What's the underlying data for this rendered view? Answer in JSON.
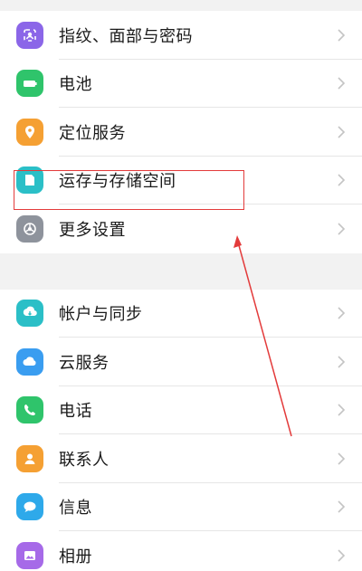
{
  "group1": [
    {
      "label": "指纹、面部与密码",
      "icon": "fingerprint-face-icon",
      "color": "#8b66e8"
    },
    {
      "label": "电池",
      "icon": "battery-icon",
      "color": "#2fc46b"
    },
    {
      "label": "定位服务",
      "icon": "location-pin-icon",
      "color": "#f5a033"
    },
    {
      "label": "运存与存储空间",
      "icon": "storage-icon",
      "color": "#2bbfc7"
    },
    {
      "label": "更多设置",
      "icon": "settings-gear-icon",
      "color": "#8e939c"
    }
  ],
  "group2": [
    {
      "label": "帐户与同步",
      "icon": "account-sync-icon",
      "color": "#2bbfc7"
    },
    {
      "label": "云服务",
      "icon": "cloud-icon",
      "color": "#3a9df0"
    },
    {
      "label": "电话",
      "icon": "phone-icon",
      "color": "#2fc46b"
    },
    {
      "label": "联系人",
      "icon": "contacts-icon",
      "color": "#f5a033"
    },
    {
      "label": "信息",
      "icon": "message-icon",
      "color": "#2ea9ea"
    },
    {
      "label": "相册",
      "icon": "gallery-icon",
      "color": "#a66ae8"
    }
  ],
  "annotation": {
    "highlight_color": "#e33b3b"
  }
}
